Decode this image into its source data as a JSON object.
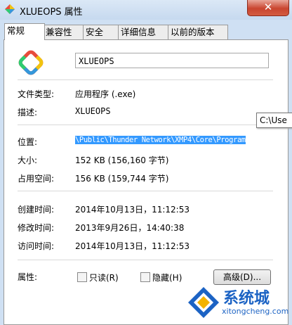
{
  "window": {
    "title": "XLUEOPS 属性",
    "close_glyph": "✕"
  },
  "tabs": [
    {
      "label": "常规",
      "active": true
    },
    {
      "label": "兼容性",
      "active": false
    },
    {
      "label": "安全",
      "active": false
    },
    {
      "label": "详细信息",
      "active": false
    },
    {
      "label": "以前的版本",
      "active": false
    }
  ],
  "general": {
    "name": "XLUEOPS",
    "rows_top": [
      {
        "label": "文件类型:",
        "value": "应用程序 (.exe)"
      },
      {
        "label": "描述:",
        "value": "XLUEOPS"
      }
    ],
    "location_label": "位置:",
    "location_value": "\\Public\\Thunder Network\\XMP4\\Core\\Program",
    "tooltip": "C:\\Use",
    "size_rows": [
      {
        "label": "大小:",
        "value": "152 KB (156,160 字节)"
      },
      {
        "label": "占用空间:",
        "value": "156 KB (159,744 字节)"
      }
    ],
    "time_rows": [
      {
        "label": "创建时间:",
        "value": "2014年10月13日，11:12:53"
      },
      {
        "label": "修改时间:",
        "value": "2013年9月26日，14:40:38"
      },
      {
        "label": "访问时间:",
        "value": "2014年10月13日，11:12:53"
      }
    ],
    "attributes_label": "属性:",
    "readonly_label": "只读(R)",
    "hidden_label": "隐藏(H)",
    "advanced_label": "高级(D)..."
  },
  "watermark": {
    "text": "系统城",
    "url": "xitongcheng.com"
  },
  "colors": {
    "selection": "#3399ff",
    "watermark": "#1c63c4"
  }
}
